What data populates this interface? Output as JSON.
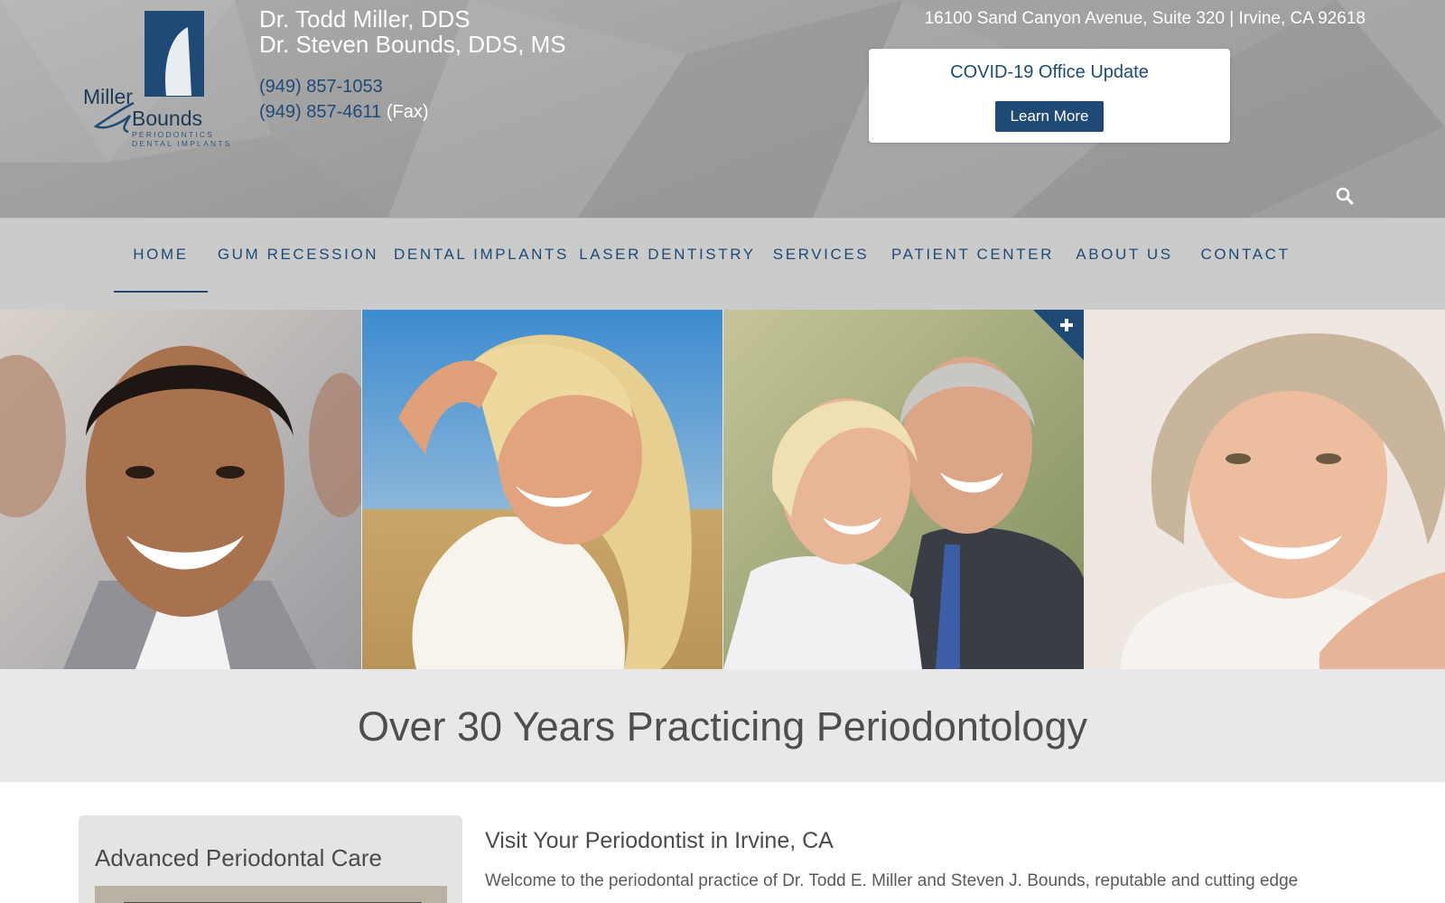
{
  "header": {
    "logo": {
      "line1": "Miller",
      "line2": "Bounds",
      "tagline1": "PERIODONTICS",
      "tagline2": "DENTAL IMPLANTS"
    },
    "doctors": [
      "Dr. Todd Miller, DDS",
      "Dr. Steven Bounds, DDS, MS"
    ],
    "phone": "(949) 857-1053",
    "fax_number": "(949) 857-4611",
    "fax_label": "(Fax)",
    "address": "16100 Sand Canyon Avenue, Suite 320 | Irvine, CA 92618",
    "covid": {
      "title": "COVID-19 Office Update",
      "button": "Learn More"
    },
    "search_icon": "search-icon"
  },
  "nav": {
    "items": [
      {
        "label": "HOME",
        "active": true
      },
      {
        "label": "GUM RECESSION"
      },
      {
        "label": "DENTAL IMPLANTS"
      },
      {
        "label": "LASER DENTISTRY"
      },
      {
        "label": "SERVICES"
      },
      {
        "label": "PATIENT CENTER"
      },
      {
        "label": "ABOUT US"
      },
      {
        "label": "CONTACT"
      }
    ]
  },
  "hero": {
    "photos": [
      "smiling-man-photo",
      "smiling-blonde-woman-photo",
      "smiling-senior-couple-photo",
      "smiling-mature-woman-photo"
    ],
    "expand_icon": "plus-icon"
  },
  "banner": {
    "headline": "Over 30 Years Practicing Periodontology"
  },
  "sidebar": {
    "title": "Advanced Periodontal Care"
  },
  "main": {
    "title": "Visit Your Periodontist in Irvine, CA",
    "intro": "Welcome to the periodontal practice of Dr. Todd E. Miller and Steven J. Bounds, reputable and cutting edge"
  },
  "colors": {
    "brand_blue": "#1f4a75",
    "header_gray": "#a6a6a6",
    "nav_gray": "#cbcbcb",
    "banner_gray": "#e8e8eb"
  }
}
